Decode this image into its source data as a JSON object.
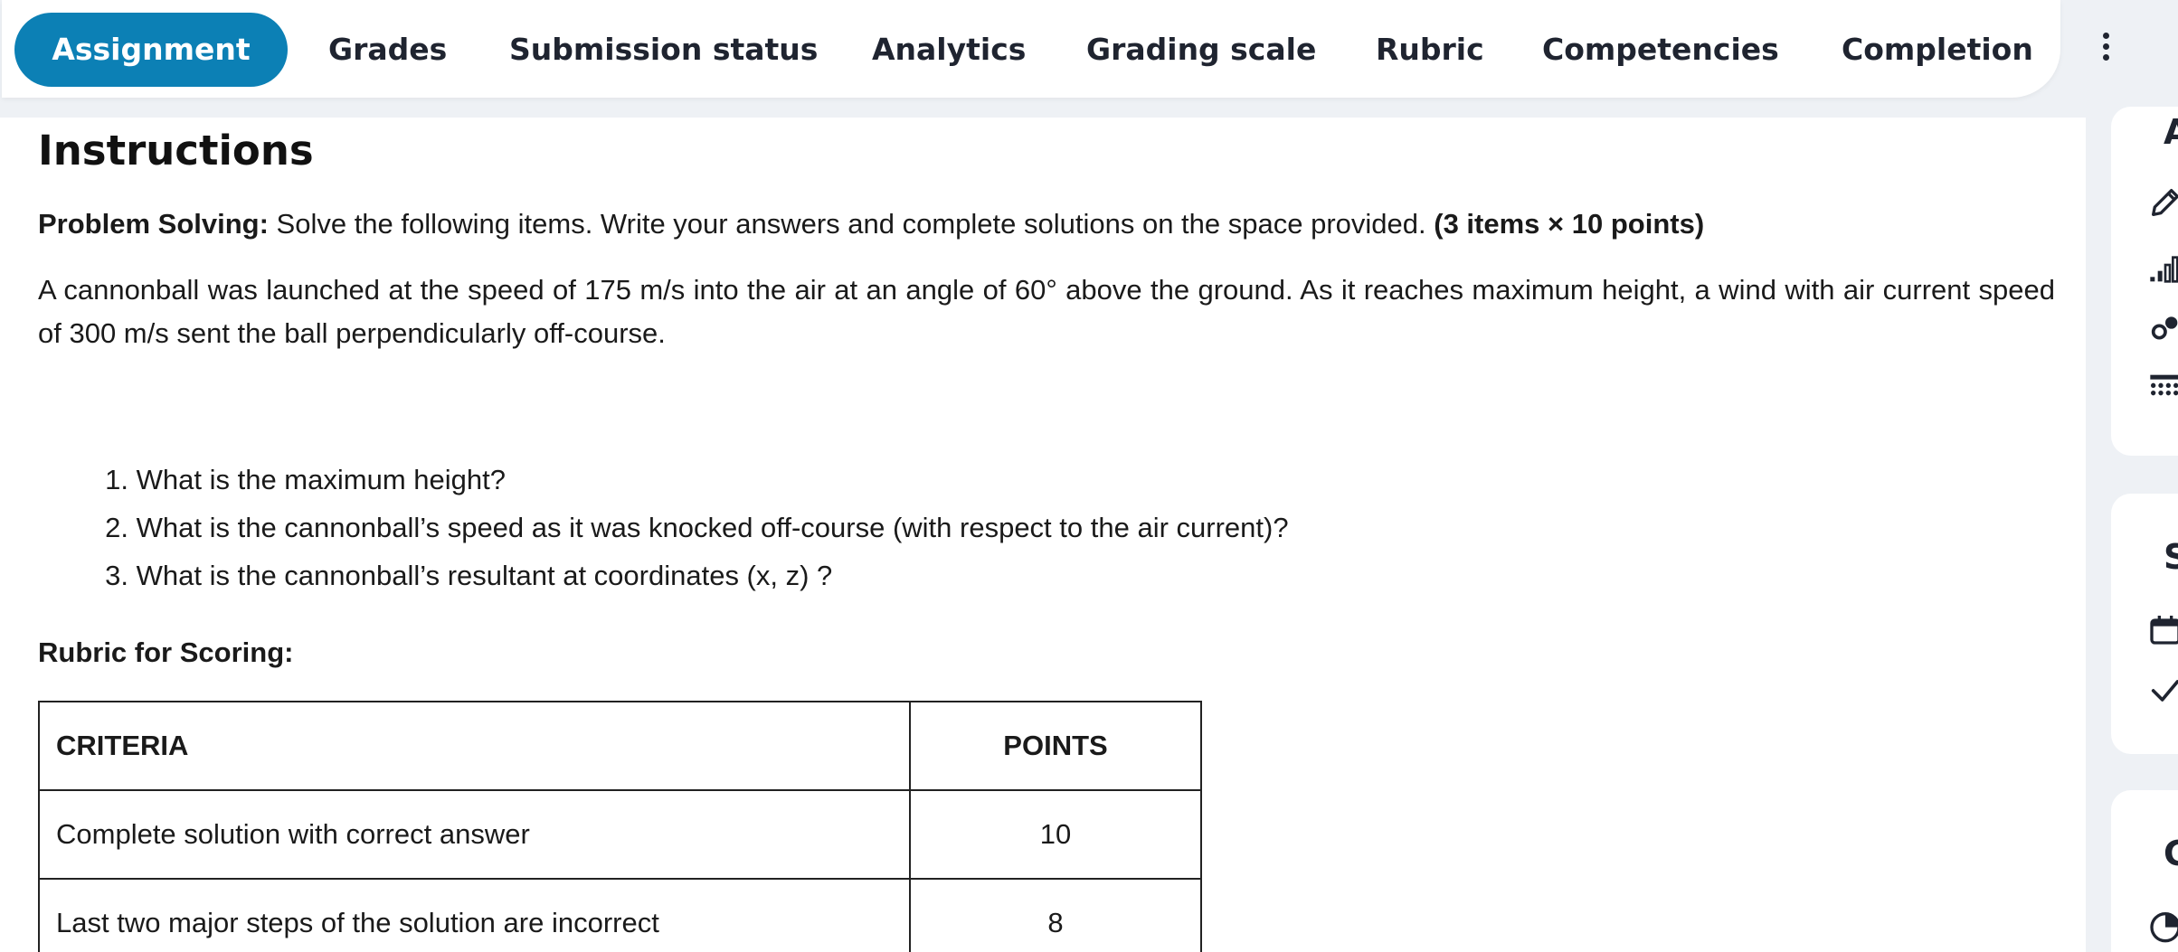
{
  "tabs": [
    {
      "label": "Assignment",
      "active": true
    },
    {
      "label": "Grades"
    },
    {
      "label": "Submission status"
    },
    {
      "label": "Analytics"
    },
    {
      "label": "Grading scale"
    },
    {
      "label": "Rubric"
    },
    {
      "label": "Competencies"
    },
    {
      "label": "Completion"
    }
  ],
  "more_icon": "more-vertical-icon",
  "instructions": {
    "heading": "Instructions",
    "problem_label": "Problem Solving:",
    "problem_text": " Solve the following items. Write your answers and complete solutions on the space provided. ",
    "problem_points": "(3 items × 10 points)",
    "scenario": "A cannonball was launched at the speed of 175 m/s into the air at an angle of 60° above the ground. As it reaches maximum height, a wind with air current speed of 300 m/s sent the ball perpendicularly off-course.",
    "questions": [
      {
        "num": "1.",
        "text": "What is the maximum height?"
      },
      {
        "num": "2.",
        "text": "What is the cannonball’s speed as it was knocked off-course (with respect to the air current)?"
      },
      {
        "num": "3.",
        "text": "What is the cannonball’s resultant at coordinates (x, z) ?"
      }
    ],
    "rubric_title": "Rubric for Scoring:",
    "rubric_headers": {
      "criteria": "CRITERIA",
      "points": "POINTS"
    },
    "rubric_rows": [
      {
        "criteria": "Complete solution with correct answer",
        "points": "10"
      },
      {
        "criteria": "Last two major steps of the solution are incorrect",
        "points": "8"
      }
    ]
  },
  "sidebar": {
    "cards": [
      {
        "letter": "A",
        "icons": [
          "pencil-icon",
          "bar-chart-icon",
          "competency-icon",
          "grid-icon"
        ]
      },
      {
        "letter": "S",
        "icons": [
          "calendar-icon",
          "check-icon"
        ]
      },
      {
        "letter": "G",
        "icons": [
          "pie-chart-icon"
        ]
      }
    ]
  }
}
